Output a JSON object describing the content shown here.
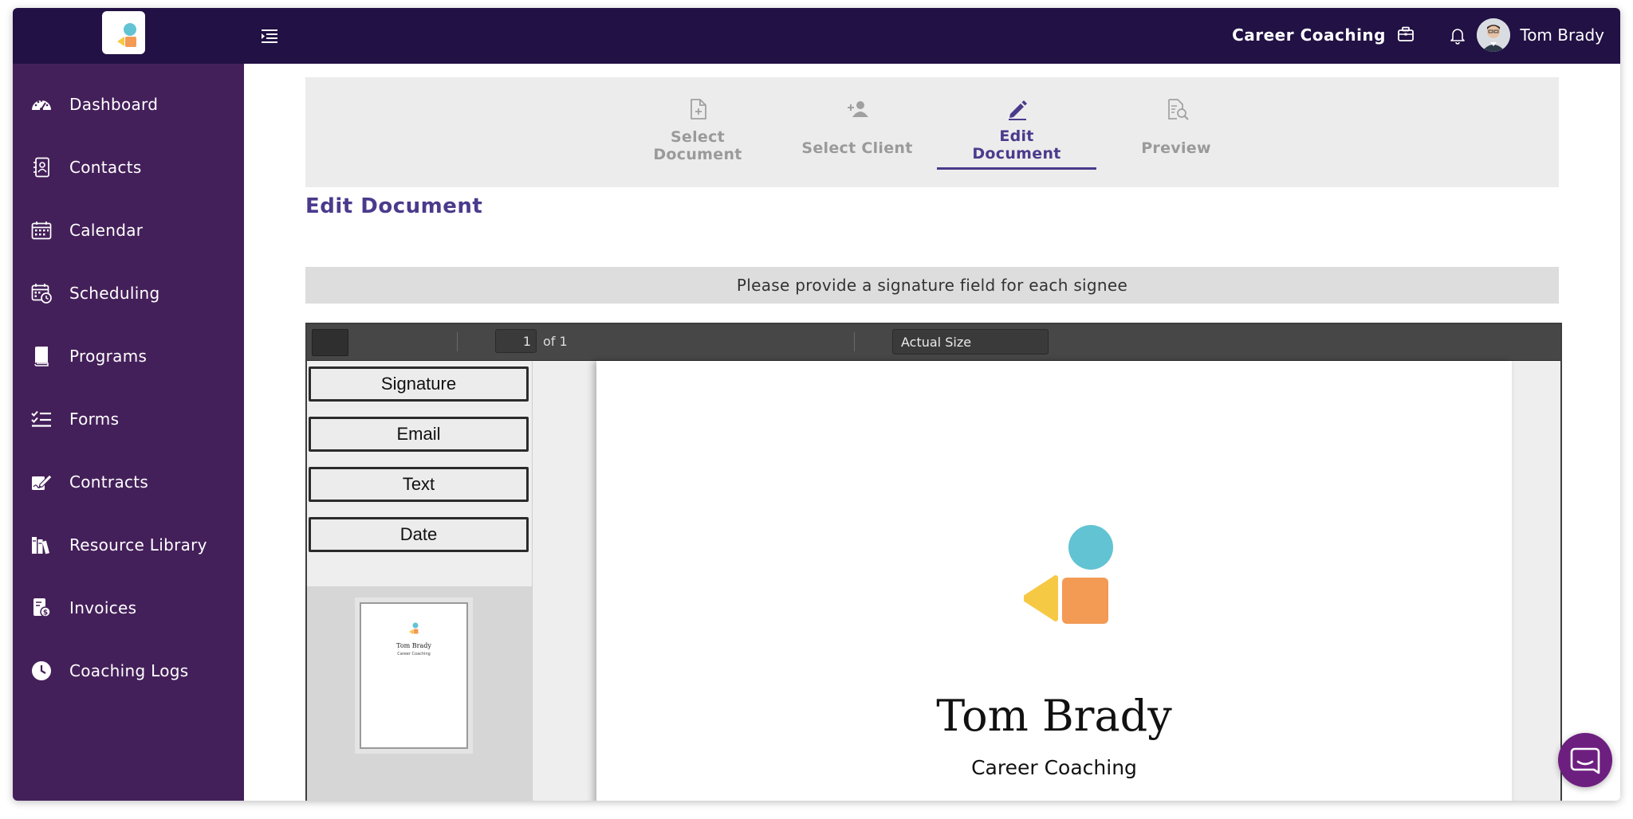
{
  "header": {
    "brand_label": "Career Coaching",
    "user_name": "Tom Brady",
    "icons": {
      "menu": "menu-toggle-icon",
      "briefcase": "briefcase-icon",
      "bell": "bell-icon",
      "avatar": "avatar"
    }
  },
  "sidebar": {
    "items": [
      {
        "label": "Dashboard",
        "icon": "dashboard-icon"
      },
      {
        "label": "Contacts",
        "icon": "contacts-icon"
      },
      {
        "label": "Calendar",
        "icon": "calendar-icon"
      },
      {
        "label": "Scheduling",
        "icon": "scheduling-icon"
      },
      {
        "label": "Programs",
        "icon": "book-icon"
      },
      {
        "label": "Forms",
        "icon": "checklist-icon"
      },
      {
        "label": "Contracts",
        "icon": "signature-icon"
      },
      {
        "label": "Resource Library",
        "icon": "library-icon"
      },
      {
        "label": "Invoices",
        "icon": "invoice-icon"
      },
      {
        "label": "Coaching Logs",
        "icon": "clock-icon"
      }
    ]
  },
  "stepper": {
    "steps": [
      {
        "label_line1": "Select",
        "label_line2": "Document",
        "icon": "file-plus-icon",
        "active": false
      },
      {
        "label_line1": "Select Client",
        "label_line2": "",
        "icon": "user-plus-icon",
        "active": false
      },
      {
        "label_line1": "Edit",
        "label_line2": "Document",
        "icon": "pencil-icon",
        "active": true
      },
      {
        "label_line1": "Preview",
        "label_line2": "",
        "icon": "file-search-icon",
        "active": false
      }
    ]
  },
  "page": {
    "title": "Edit Document",
    "notice": "Please provide a signature field for each signee"
  },
  "viewer": {
    "page_number": "1",
    "page_of": "of 1",
    "zoom": "Actual Size",
    "fields": [
      "Signature",
      "Email",
      "Text",
      "Date"
    ],
    "thumbnail": {
      "name": "Tom Brady",
      "subtitle": "Career Coaching"
    },
    "document": {
      "name": "Tom Brady",
      "subtitle": "Career Coaching"
    }
  },
  "colors": {
    "header_bg": "#211144",
    "sidebar_bg": "#44205a",
    "accent": "#4b3a8c",
    "logo_teal": "#62c3d3",
    "logo_yellow": "#f6c945",
    "logo_orange": "#f39a55",
    "chat_bg": "#6d1f80"
  }
}
